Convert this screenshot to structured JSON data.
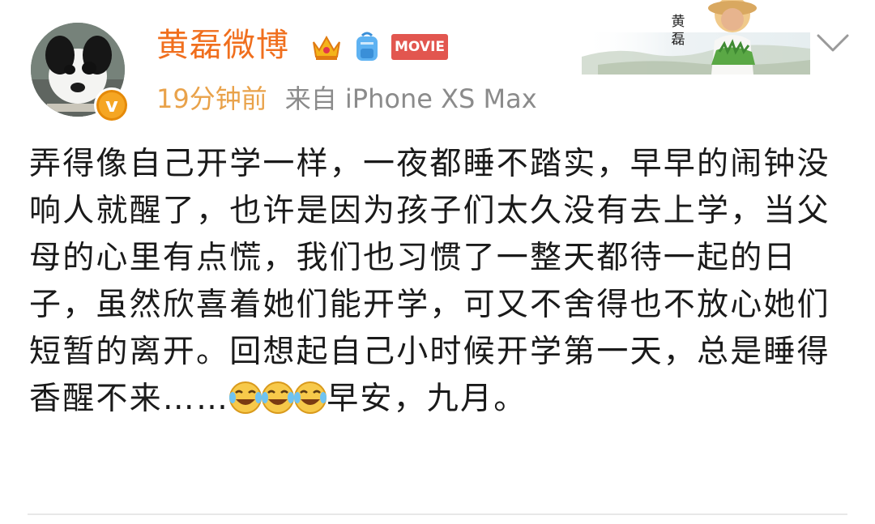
{
  "post": {
    "author": {
      "name": "黄磊微博",
      "verified_badge": "v",
      "badges": [
        "crown-icon",
        "backpack-icon",
        "movie-icon"
      ],
      "movie_badge_text": "MOVIE"
    },
    "meta": {
      "time": "19分钟前",
      "source": "来自 iPhone XS Max"
    },
    "cover": {
      "name_vertical": "黄\n磊"
    },
    "text_before_emoji": "弄得像自己开学一样，一夜都睡不踏实，早早的闹钟没响人就醒了，也许是因为孩子们太久没有去上学，当父母的心里有点慌，我们也习惯了一整天都待一起的日子，虽然欣喜着她们能开学，可又不舍得也不放心她们短暂的离开。回想起自己小时候开学第一天，总是睡得香醒不来……",
    "emoji": [
      "laugh-cry-emoji",
      "laugh-cry-emoji",
      "laugh-cry-emoji"
    ],
    "text_after_emoji": "早安，九月。"
  },
  "colors": {
    "username": "#f06f1e",
    "time": "#e9a24a",
    "source": "#8b8b8b",
    "verified": "#f5a623",
    "text": "#1a1a1a"
  }
}
